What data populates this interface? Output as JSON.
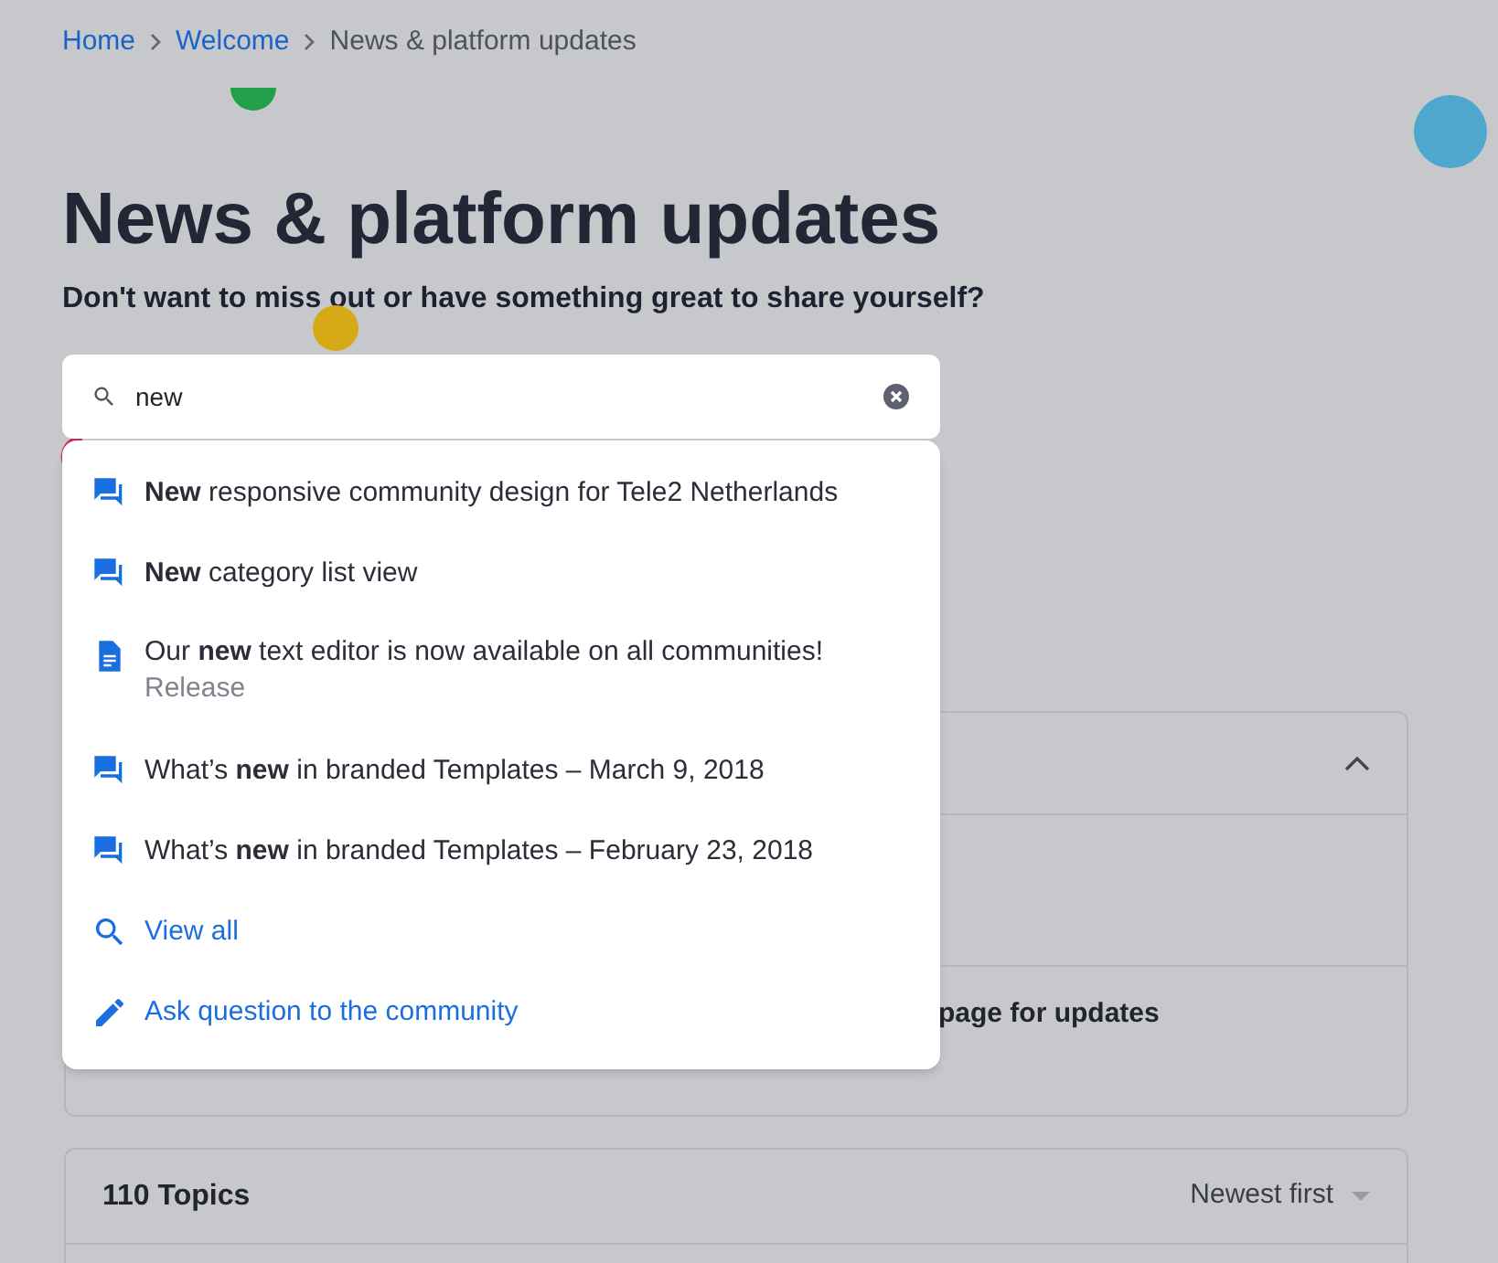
{
  "breadcrumb": [
    {
      "label": "Home",
      "kind": "link"
    },
    {
      "label": "Welcome",
      "kind": "link"
    },
    {
      "label": "News & platform updates",
      "kind": "current"
    }
  ],
  "title": "News & platform updates",
  "subtitle": "Don't want to miss out or have something great to share yourself?",
  "search": {
    "value": "new"
  },
  "suggestions": [
    {
      "kind": "topic",
      "text": "**New** responsive community design for Tele2 Netherlands"
    },
    {
      "kind": "topic",
      "text": "**New** category list view"
    },
    {
      "kind": "article",
      "text": "Our **new** text editor is now available on all communities!",
      "meta": "Release"
    },
    {
      "kind": "topic",
      "text": "What’s **new** in branded Templates – March 9, 2018"
    },
    {
      "kind": "topic",
      "text": "What’s **new** in branded Templates – February 23, 2018"
    },
    {
      "kind": "view-all",
      "text": "View all"
    },
    {
      "kind": "ask",
      "text": "Ask question to the community"
    }
  ],
  "featured_card": {
    "expanded": true,
    "row_3": "page for updates"
  },
  "topics": {
    "count": "110 Topics",
    "sort": "Newest first"
  }
}
